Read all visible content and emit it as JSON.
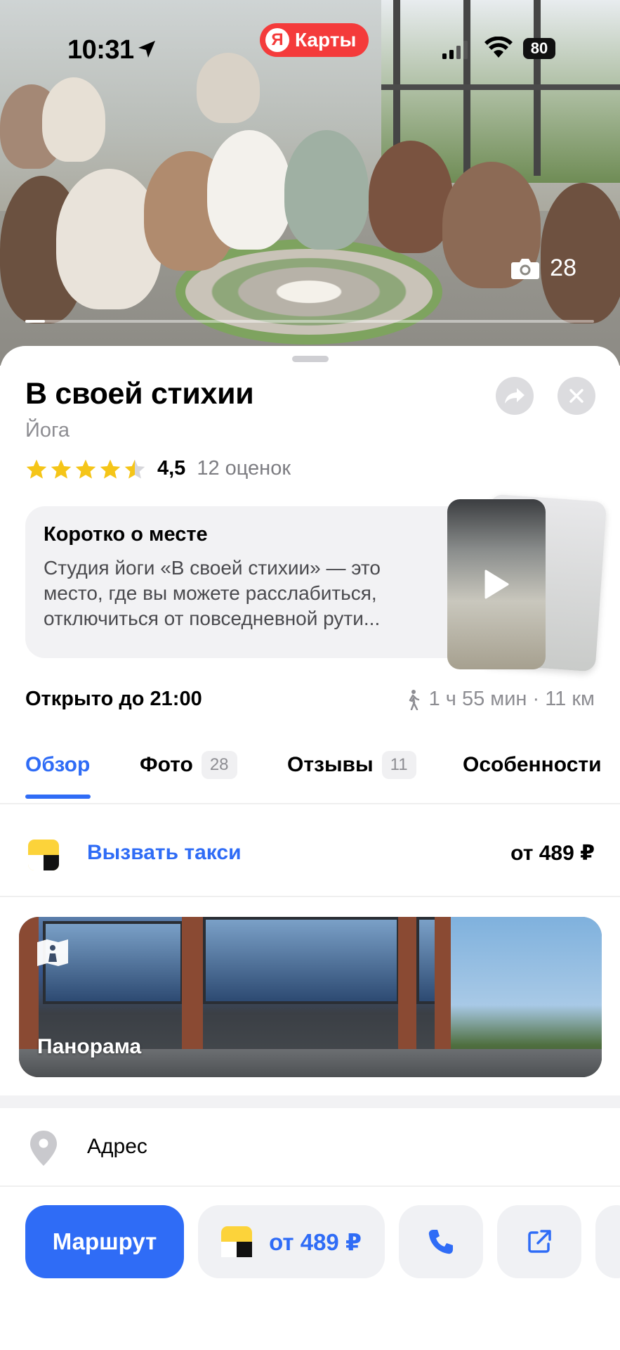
{
  "status_bar": {
    "time": "10:31",
    "battery": "80",
    "app_badge": "Карты",
    "app_badge_logo": "Я"
  },
  "hero": {
    "photo_count": "28",
    "gallery_progress": 0.035,
    "icon_camera": "camera-icon"
  },
  "place": {
    "title": "В своей стихии",
    "category": "Йога",
    "rating": "4,5",
    "rating_stars": 4.5,
    "reviews_count": "12 оценок",
    "share_icon": "share-icon",
    "close_icon": "close-icon"
  },
  "about": {
    "title": "Коротко о месте",
    "text": "Студия йоги «В своей стихии» — это место, где вы можете расслабиться, отключиться от повседневной рути..."
  },
  "info": {
    "hours": "Открыто до 21:00",
    "distance": "1 ч 55 мин · 11 км"
  },
  "tabs": [
    {
      "label": "Обзор",
      "badge": "",
      "active": true
    },
    {
      "label": "Фото",
      "badge": "28",
      "active": false
    },
    {
      "label": "Отзывы",
      "badge": "11",
      "active": false
    },
    {
      "label": "Особенности",
      "badge": "",
      "active": false
    }
  ],
  "taxi": {
    "label": "Вызвать такси",
    "price": "от 489 ₽"
  },
  "panorama": {
    "label": "Панорама"
  },
  "address": {
    "label": "Адрес"
  },
  "actions": {
    "route": "Маршрут",
    "taxi_price": "от 489 ₽"
  },
  "colors": {
    "accent": "#2f6cf6",
    "star": "#f5c518",
    "app_badge": "#f43b3b",
    "taxi_yellow": "#fcd33a"
  }
}
